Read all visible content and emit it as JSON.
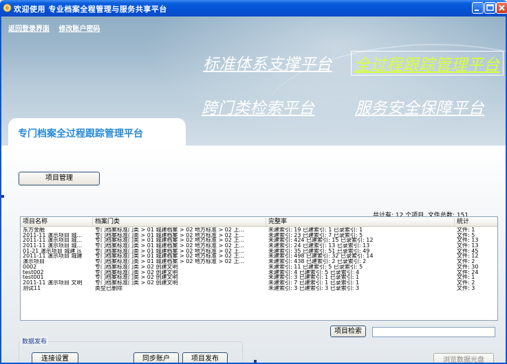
{
  "window": {
    "title": "欢迎使用  专业档案全程管理与服务共享平台"
  },
  "banner": {
    "links": [
      "返回登录界面",
      "修改账户密码"
    ],
    "platforms": [
      "标准体系支撑平台",
      "全过程跟踪管理平台",
      "跨门类检索平台",
      "服务安全保障平台"
    ],
    "active_platform": "全过程跟踪管理平台"
  },
  "tab": {
    "label": "专门档案全过程跟踪管理平台"
  },
  "buttons": {
    "project_manage": "项目管理",
    "project_search": "项目检索",
    "browse_disc": "浏览数据光盘",
    "connect_settings": "连接设置",
    "sync_account": "同步账户",
    "project_publish": "项目发布"
  },
  "summary": "共计有:  12   个项目, 文件总数:  151",
  "data_publish_label": "数据发布",
  "table": {
    "columns": [
      "项目名称",
      "档案门类",
      "完整率",
      "统计"
    ],
    "rows": [
      [
        "东方金融",
        "专门档案标准门类 > 01 城建档案 > 02 地方标准 > 02 上...",
        "未建索引: 19   已建索引: 1   已录索引: 1",
        "文件: 1"
      ],
      [
        "2011-11 演示项目 城...",
        "专门档案标准门类 > 01 城建档案 > 02 地方标准 > 02 上...",
        "未建索引: 23   已建索引: 7   已录索引: 5",
        "文件: 5"
      ],
      [
        "2011-11 演示项目 城...",
        "专门档案标准门类 > 01 城建档案 > 02 地方标准 > 02 上...",
        "未建索引: 424   已建索引: 15   已录索引: 12",
        "文件: 13"
      ],
      [
        "2011-11 演示项目 城...",
        "专门档案标准门类 > 01 城建档案 > 02 地方标准 > 02 上...",
        "未建索引: 24   已建索引: 13   已录索引: 13",
        "文件: 13"
      ],
      [
        "01-21 演示项目 城建 js",
        "专门档案标准门类 > 01 城建档案 > 02 地方标准 > 02 上...",
        "未建索引: 35   已建索引: 51   已录索引: 49",
        "文件: 45"
      ],
      [
        "2011-11 演示项目 城建",
        "专门档案标准门类 > 01 城建档案 > 02 地方标准 > 02 上...",
        "未建索引: 498   已建索引: 32   已录索引: 14",
        "文件: 12"
      ],
      [
        "演示项目",
        "专门档案标准门类 > 01 城建档案 > 02 地方标准 > 02 上...",
        "未建索引: 438   已建索引: 2   已录索引: 2",
        "文件: 2"
      ],
      [
        "0002",
        "专门档案标准门类 > 02 创建文明",
        "未建索引: 11   已建索引: 5   已录索引: 5",
        "文件: 30"
      ],
      [
        "test002",
        "专门档案标准门类 > 02 创建文明",
        "未建索引: 4   已建索引: 5   已录索引: 4",
        "文件: 24"
      ],
      [
        "test001",
        "专门档案标准门类 > 02 创建文明",
        "未建索引: 3   已建索引: 1   已录索引: 1",
        "文件: 1"
      ],
      [
        "2011-11 演示项目 文明",
        "专门档案标准门类 > 02 创建文明",
        "未建索引: 7   已建索引: 1   已录索引: 1",
        "文件: 2"
      ],
      [
        "测试11",
        "类型已删除",
        "未建索引: 3   已建索引: 3   已录索引: 3",
        "文件: 3"
      ]
    ]
  }
}
